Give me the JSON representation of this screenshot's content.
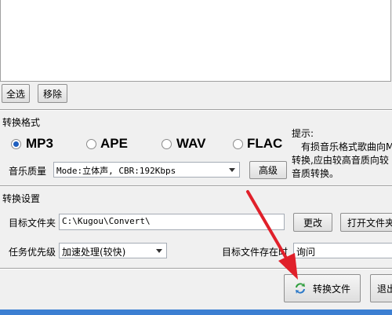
{
  "list_buttons": {
    "select_all": "全选",
    "remove": "移除"
  },
  "format_section": {
    "title": "转换格式",
    "formats": [
      {
        "label": "MP3",
        "selected": true
      },
      {
        "label": "APE",
        "selected": false
      },
      {
        "label": "WAV",
        "selected": false
      },
      {
        "label": "FLAC",
        "selected": false
      }
    ],
    "quality_label": "音乐质量",
    "quality_value": "Mode:立体声, CBR:192Kbps",
    "advanced_button": "高级",
    "tip_title": "提示:",
    "tip_lines": [
      "有损音乐格式歌曲向MP",
      "转换,应由较高音质向较",
      "音质转换。"
    ]
  },
  "settings_section": {
    "title": "转换设置",
    "target_folder_label": "目标文件夹",
    "target_folder_value": "C:\\Kugou\\Convert\\",
    "change_button": "更改",
    "open_folder_button": "打开文件夹",
    "priority_label": "任务优先级",
    "priority_value": "加速处理(较快)",
    "exists_label": "目标文件存在时",
    "exists_value": "询问"
  },
  "actions": {
    "convert_button": "转换文件",
    "exit_button": "退出"
  },
  "colors": {
    "accent": "#3c7fd2",
    "arrow": "#e0202a"
  }
}
